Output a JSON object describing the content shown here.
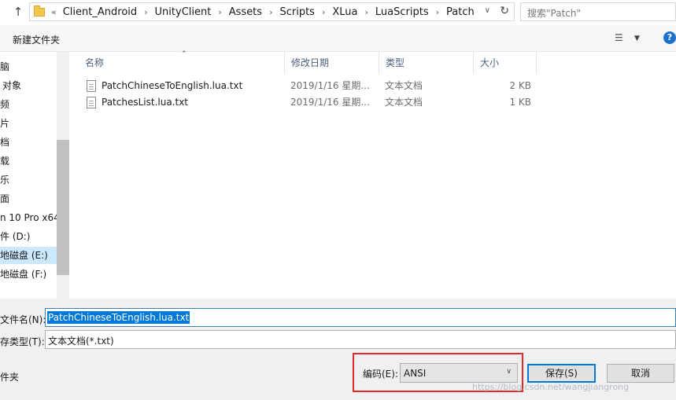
{
  "addressbar": {
    "overflow": "«",
    "crumbs": [
      "Client_Android",
      "UnityClient",
      "Assets",
      "Scripts",
      "XLua",
      "LuaScripts",
      "Patch"
    ],
    "search_placeholder": "搜索\"Patch\""
  },
  "toolbar": {
    "new_folder": "新建文件夹",
    "help": "?"
  },
  "nav": {
    "items": [
      {
        "label": "脑"
      },
      {
        "label": "对象"
      },
      {
        "label": "频"
      },
      {
        "label": "片"
      },
      {
        "label": "档"
      },
      {
        "label": "载"
      },
      {
        "label": "乐"
      },
      {
        "label": "面"
      },
      {
        "label": "n 10 Pro x64"
      },
      {
        "label": "件 (D:)"
      },
      {
        "label": "地磁盘 (E:)"
      },
      {
        "label": "地磁盘 (F:)"
      }
    ]
  },
  "filelist": {
    "columns": [
      "名称",
      "修改日期",
      "类型",
      "大小"
    ],
    "rows": [
      {
        "name": "PatchChineseToEnglish.lua.txt",
        "date": "2019/1/16 星期...",
        "type": "文本文档",
        "size": "2 KB"
      },
      {
        "name": "PatchesList.lua.txt",
        "date": "2019/1/16 星期...",
        "type": "文本文档",
        "size": "1 KB"
      }
    ]
  },
  "save": {
    "filename_label": "文件名(N):",
    "filename_value": "PatchChineseToEnglish.lua.txt",
    "filetype_label": "存类型(T):",
    "filetype_value": "文本文档(*.txt)",
    "hide_folders_label": "件夹",
    "encoding_label": "编码(E):",
    "encoding_value": "ANSI",
    "save_button": "保存(S)",
    "cancel_button": "取消"
  },
  "watermark": "https://blog.csdn.net/wangjiangrong",
  "colors": {
    "accent": "#0078d7",
    "highlight_box": "#e12b2b",
    "selection": "#cce8ff"
  }
}
